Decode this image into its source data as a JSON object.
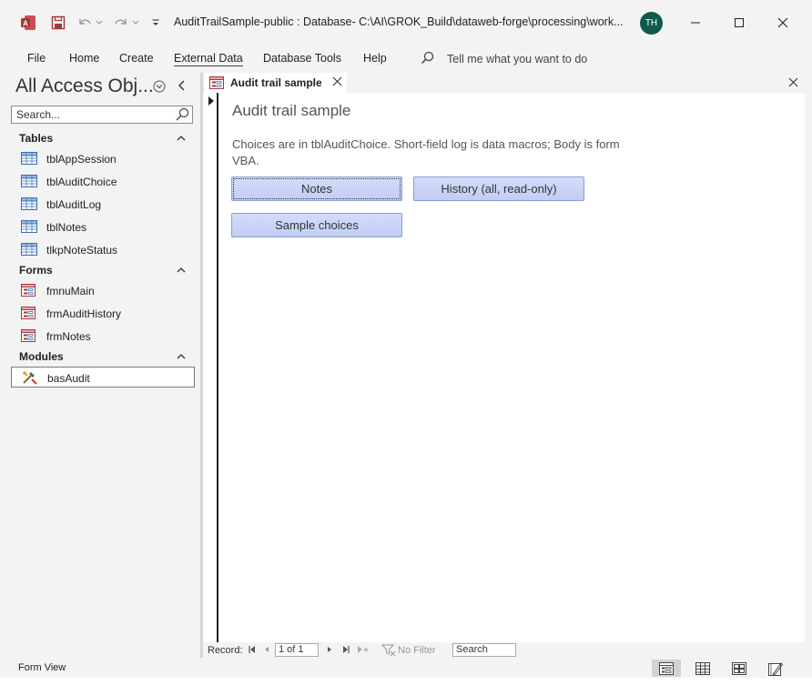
{
  "window": {
    "title": "AuditTrailSample-public : Database- C:\\AI\\GROK_Build\\dataweb-forge\\processing\\work...",
    "avatar_initials": "TH",
    "app_icon": "access-icon"
  },
  "ribbon": {
    "tabs": [
      "File",
      "Home",
      "Create",
      "External Data",
      "Database Tools",
      "Help"
    ],
    "active_tab": "External Data",
    "tell_me": "Tell me what you want to do"
  },
  "nav": {
    "title": "All Access Obj...",
    "search_placeholder": "Search...",
    "groups": [
      {
        "label": "Tables",
        "items": [
          "tblAppSession",
          "tblAuditChoice",
          "tblAuditLog",
          "tblNotes",
          "tlkpNoteStatus"
        ]
      },
      {
        "label": "Forms",
        "items": [
          "fmnuMain",
          "frmAuditHistory",
          "frmNotes"
        ]
      },
      {
        "label": "Modules",
        "items": [
          "basAudit"
        ]
      }
    ],
    "selected_item": "basAudit"
  },
  "document": {
    "tab_label": "Audit trail sample",
    "form_title": "Audit trail sample",
    "description": "Choices are in tblAuditChoice. Short-field log is data macros; Body is form VBA.",
    "buttons": {
      "notes": "Notes",
      "history": "History (all, read-only)",
      "sample_choices": "Sample choices"
    }
  },
  "record_nav": {
    "label": "Record:",
    "position": "1 of 1",
    "filter": "No Filter",
    "search": "Search"
  },
  "status": {
    "view": "Form View"
  },
  "colors": {
    "accent_button": "#c8d2f7",
    "avatar": "#0f5a4c",
    "access_red": "#a4373a"
  }
}
